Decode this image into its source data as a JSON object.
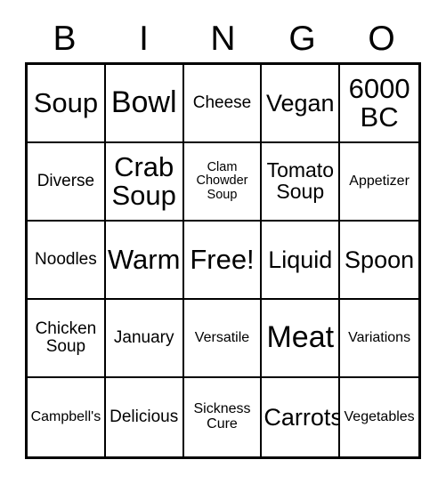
{
  "card": {
    "header_letters": [
      "B",
      "I",
      "N",
      "G",
      "O"
    ],
    "columns": 5,
    "rows": 5,
    "colors": {
      "background": "#ffffff",
      "text": "#000000",
      "border": "#000000"
    },
    "cells": [
      {
        "text": "Soup",
        "size": "lg"
      },
      {
        "text": "Bowl",
        "size": "xl"
      },
      {
        "text": "Cheese",
        "size": "xs"
      },
      {
        "text": "Vegan",
        "size": "md"
      },
      {
        "text": "6000\nBC",
        "size": "lg"
      },
      {
        "text": "Diverse",
        "size": "xs"
      },
      {
        "text": "Crab\nSoup",
        "size": "lg"
      },
      {
        "text": "Clam\nChowder\nSoup",
        "size": "tiny"
      },
      {
        "text": "Tomato\nSoup",
        "size": "sm"
      },
      {
        "text": "Appetizer",
        "size": "xxs"
      },
      {
        "text": "Noodles",
        "size": "xs"
      },
      {
        "text": "Warm",
        "size": "lg"
      },
      {
        "text": "Free!",
        "size": "lg"
      },
      {
        "text": "Liquid",
        "size": "md"
      },
      {
        "text": "Spoon",
        "size": "md"
      },
      {
        "text": "Chicken\nSoup",
        "size": "xs"
      },
      {
        "text": "January",
        "size": "xs"
      },
      {
        "text": "Versatile",
        "size": "xxs"
      },
      {
        "text": "Meat",
        "size": "xl"
      },
      {
        "text": "Variations",
        "size": "xxs"
      },
      {
        "text": "Campbell's",
        "size": "xxs"
      },
      {
        "text": "Delicious",
        "size": "xs"
      },
      {
        "text": "Sickness\nCure",
        "size": "xxs"
      },
      {
        "text": "Carrots",
        "size": "md"
      },
      {
        "text": "Vegetables",
        "size": "xxs"
      }
    ]
  }
}
